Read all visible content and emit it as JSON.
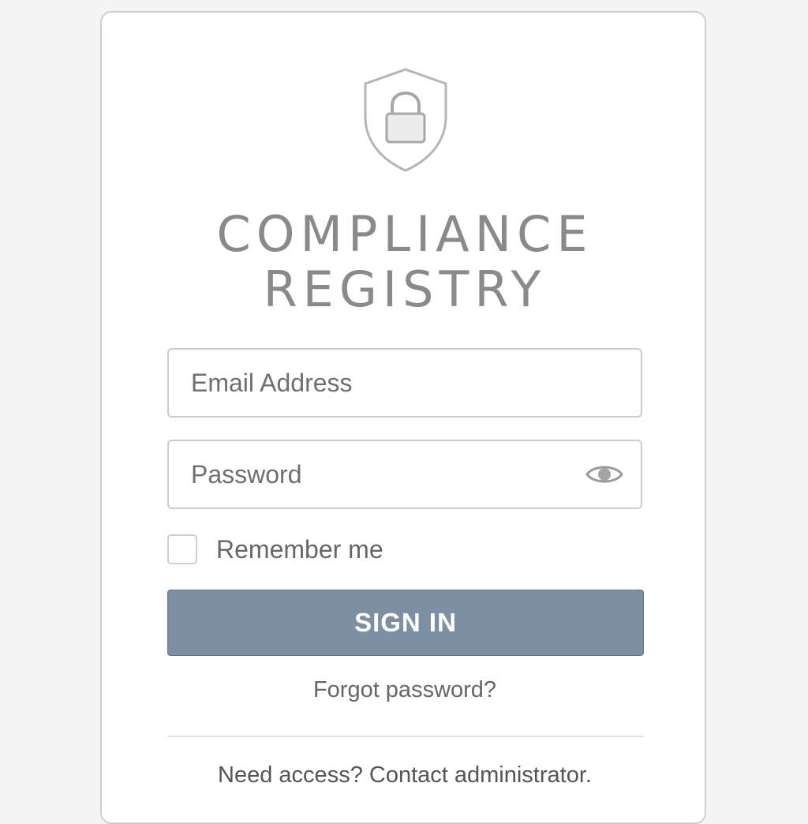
{
  "app": {
    "title_line1": "COMPLIANCE",
    "title_line2": "REGISTRY",
    "logo_icon": "shield-lock-icon"
  },
  "form": {
    "email": {
      "value": "",
      "placeholder": "Email Address"
    },
    "password": {
      "value": "",
      "placeholder": "Password",
      "toggle_icon": "eye-icon"
    },
    "remember_label": "Remember me",
    "remember_checked": false,
    "signin_label": "SIGN IN",
    "forgot_label": "Forgot password?",
    "access_label": "Need access? Contact administrator."
  },
  "colors": {
    "primary_button": "#7d90a3",
    "title_text": "#8a8a8a",
    "border": "#cccccc"
  }
}
